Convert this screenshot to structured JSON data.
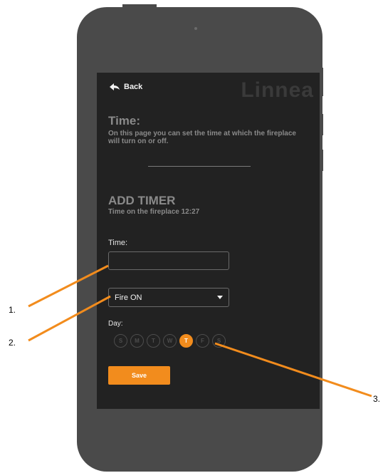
{
  "nav": {
    "back_label": "Back"
  },
  "brand": "Linnea",
  "time_section": {
    "heading": "Time:",
    "description": "On this page you can set the time at which the fireplace will turn on or off."
  },
  "add_timer": {
    "heading": "ADD TIMER",
    "subtitle": "Time on the fireplace 12:27"
  },
  "form": {
    "time_label": "Time:",
    "time_value": "",
    "fire_select_value": "Fire ON",
    "day_label": "Day:",
    "days": [
      "S",
      "M",
      "T",
      "W",
      "T",
      "F",
      "S"
    ],
    "active_day_index": 4,
    "save_label": "Save"
  },
  "callouts": [
    "1.",
    "2.",
    "3."
  ],
  "colors": {
    "accent": "#f28c1d",
    "screen_bg": "#222222",
    "phone_body": "#4a4a4a"
  }
}
